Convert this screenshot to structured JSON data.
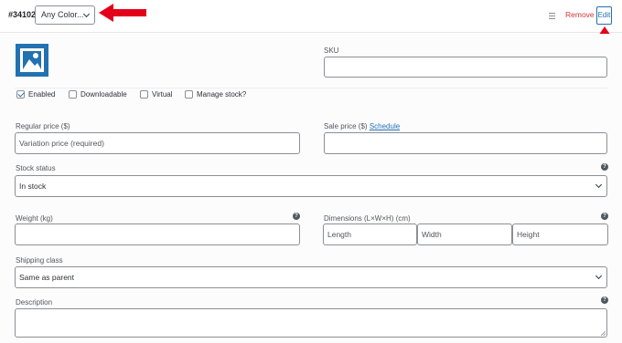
{
  "header": {
    "variation_id": "#34102",
    "attribute_select": "Any Color...",
    "remove_label": "Remove",
    "edit_label": "Edit"
  },
  "fields": {
    "sku_label": "SKU",
    "enabled_label": "Enabled",
    "downloadable_label": "Downloadable",
    "virtual_label": "Virtual",
    "manage_stock_label": "Manage stock?",
    "regular_price_label": "Regular price ($)",
    "regular_price_placeholder": "Variation price (required)",
    "sale_price_label": "Sale price ($)",
    "schedule_label": "Schedule",
    "stock_status_label": "Stock status",
    "stock_status_value": "In stock",
    "weight_label": "Weight (kg)",
    "dimensions_label": "Dimensions (L×W×H) (cm)",
    "length_placeholder": "Length",
    "width_placeholder": "Width",
    "height_placeholder": "Height",
    "shipping_class_label": "Shipping class",
    "shipping_class_value": "Same as parent",
    "description_label": "Description",
    "help_glyph": "?"
  },
  "checkboxes": {
    "enabled": true,
    "downloadable": false,
    "virtual": false,
    "manage_stock": false
  },
  "colors": {
    "accent": "#2271b1",
    "remove": "#d63638",
    "annotation_arrow": "#e3001b"
  }
}
